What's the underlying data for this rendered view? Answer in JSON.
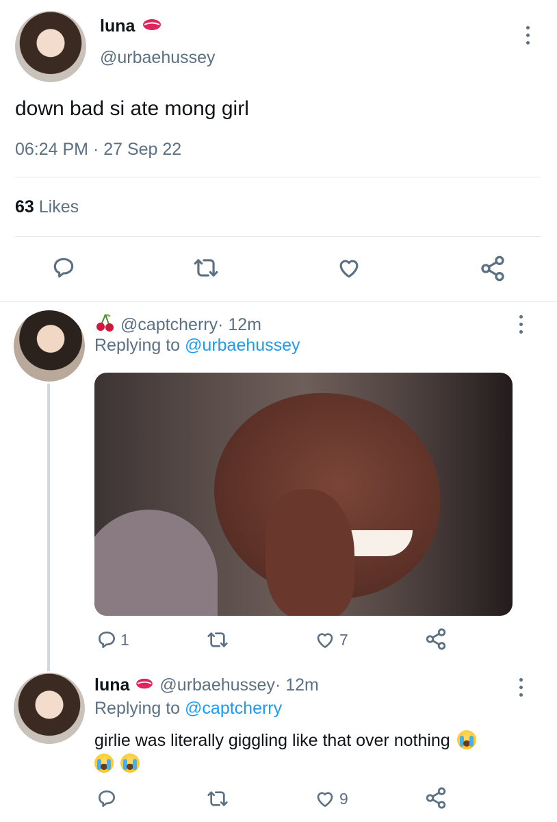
{
  "main_tweet": {
    "display_name": "luna",
    "name_emoji_icon": "kiss-mark-icon",
    "handle": "@urbaehussey",
    "text": "down bad si ate mong girl",
    "timestamp": "06:24 PM · 27 Sep 22",
    "likes_count": "63",
    "likes_label": "Likes"
  },
  "reply1": {
    "name_emoji_icon": "cherries-icon",
    "handle": "@captcherry",
    "time": " · 12m",
    "replying_prefix": "Replying to ",
    "replying_to": "@urbaehussey",
    "reply_count": "1",
    "retweet_count": "",
    "like_count": "7"
  },
  "reply2": {
    "display_name": "luna",
    "name_emoji_icon": "kiss-mark-icon",
    "handle": "@urbaehussey",
    "time": " · 12m",
    "replying_prefix": "Replying to ",
    "replying_to": "@captcherry",
    "text": "girlie was literally giggling like that over nothing",
    "emoji_icon": "loudly-crying-face-icon",
    "reply_count": "",
    "like_count": "9"
  },
  "colors": {
    "link_blue": "#1d9bf0",
    "secondary_gray": "#5b7083",
    "divider": "#e1e8ed",
    "kiss_red": "#e0245e"
  }
}
